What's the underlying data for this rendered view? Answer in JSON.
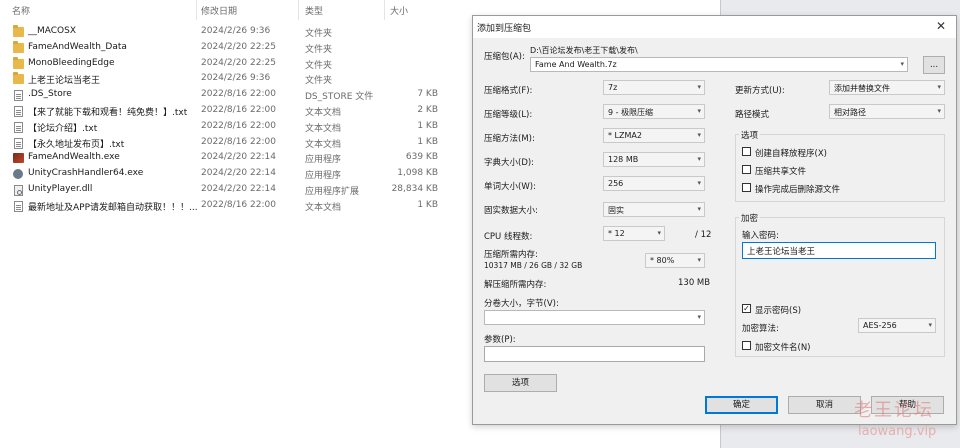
{
  "explorer": {
    "columns": {
      "name": "名称",
      "date": "修改日期",
      "type": "类型",
      "size": "大小"
    },
    "files": [
      {
        "icon": "folder-icon",
        "name": "__MACOSX",
        "date": "2024/2/26 9:36",
        "type": "文件夹",
        "size": ""
      },
      {
        "icon": "folder-icon",
        "name": "FameAndWealth_Data",
        "date": "2024/2/20 22:25",
        "type": "文件夹",
        "size": ""
      },
      {
        "icon": "folder-icon",
        "name": "MonoBleedingEdge",
        "date": "2024/2/20 22:25",
        "type": "文件夹",
        "size": ""
      },
      {
        "icon": "folder-icon",
        "name": "上老王论坛当老王",
        "date": "2024/2/26 9:36",
        "type": "文件夹",
        "size": ""
      },
      {
        "icon": "document-icon",
        "name": ".DS_Store",
        "date": "2022/8/16 22:00",
        "type": "DS_STORE 文件",
        "size": "7 KB"
      },
      {
        "icon": "document-icon",
        "name": "【来了就能下载和观看！纯免费！】.txt",
        "date": "2022/8/16 22:00",
        "type": "文本文档",
        "size": "2 KB"
      },
      {
        "icon": "document-icon",
        "name": "【论坛介绍】.txt",
        "date": "2022/8/16 22:00",
        "type": "文本文档",
        "size": "1 KB"
      },
      {
        "icon": "document-icon",
        "name": "【永久地址发布页】.txt",
        "date": "2022/8/16 22:00",
        "type": "文本文档",
        "size": "1 KB"
      },
      {
        "icon": "exe-icon",
        "name": "FameAndWealth.exe",
        "date": "2024/2/20 22:14",
        "type": "应用程序",
        "size": "639 KB"
      },
      {
        "icon": "gear-icon",
        "name": "UnityCrashHandler64.exe",
        "date": "2024/2/20 22:14",
        "type": "应用程序",
        "size": "1,098 KB"
      },
      {
        "icon": "dll-icon",
        "name": "UnityPlayer.dll",
        "date": "2024/2/20 22:14",
        "type": "应用程序扩展",
        "size": "28,834 KB"
      },
      {
        "icon": "document-icon",
        "name": "最新地址及APP请发邮箱自动获取！！！...",
        "date": "2022/8/16 22:00",
        "type": "文本文档",
        "size": "1 KB"
      }
    ]
  },
  "dialog": {
    "title": "添加到压缩包",
    "close_glyph": "✕",
    "archive": {
      "label": "压缩包(A):",
      "path": "D:\\百论坛发布\\老王下载\\发布\\",
      "name": "Fame And Wealth.7z",
      "browse_label": "..."
    },
    "left": {
      "format": {
        "label": "压缩格式(F):",
        "value": "7z"
      },
      "level": {
        "label": "压缩等级(L):",
        "value": "9 - 极限压缩"
      },
      "method": {
        "label": "压缩方法(M):",
        "value": "* LZMA2"
      },
      "dict": {
        "label": "字典大小(D):",
        "value": "128 MB"
      },
      "word": {
        "label": "单词大小(W):",
        "value": "256"
      },
      "solid": {
        "label": "固实数据大小:",
        "value": "固实"
      },
      "threads": {
        "label": "CPU 线程数:",
        "value": "* 12",
        "max": "/ 12"
      },
      "mem_compress": {
        "label": "压缩所需内存:",
        "detail": "10317 MB / 26 GB / 32 GB",
        "value": "* 80%"
      },
      "mem_decompress": {
        "label": "解压缩所需内存:",
        "value": "130 MB"
      },
      "split": {
        "label": "分卷大小，字节(V):",
        "value": ""
      },
      "params": {
        "label": "参数(P):",
        "value": ""
      },
      "options_button": "选项"
    },
    "right": {
      "update": {
        "label": "更新方式(U):",
        "value": "添加并替换文件"
      },
      "path_mode": {
        "label": "路径模式",
        "value": "相对路径"
      },
      "options": {
        "title": "选项",
        "sfx": {
          "label": "创建自释放程序(X)",
          "checked": false
        },
        "shared": {
          "label": "压缩共享文件",
          "checked": false
        },
        "delete": {
          "label": "操作完成后删除源文件",
          "checked": false
        }
      },
      "encryption": {
        "title": "加密",
        "password_label": "输入密码:",
        "password": "上老王论坛当老王",
        "show_password": {
          "label": "显示密码(S)",
          "checked": true,
          "glyph": "✓"
        },
        "method_label": "加密算法:",
        "method_value": "AES-256",
        "encrypt_names": {
          "label": "加密文件名(N)",
          "checked": false
        }
      }
    },
    "buttons": {
      "ok": "确定",
      "cancel": "取消",
      "help": "帮助"
    }
  },
  "watermark": {
    "cn": "老王论坛",
    "en": "laowang.vip"
  }
}
